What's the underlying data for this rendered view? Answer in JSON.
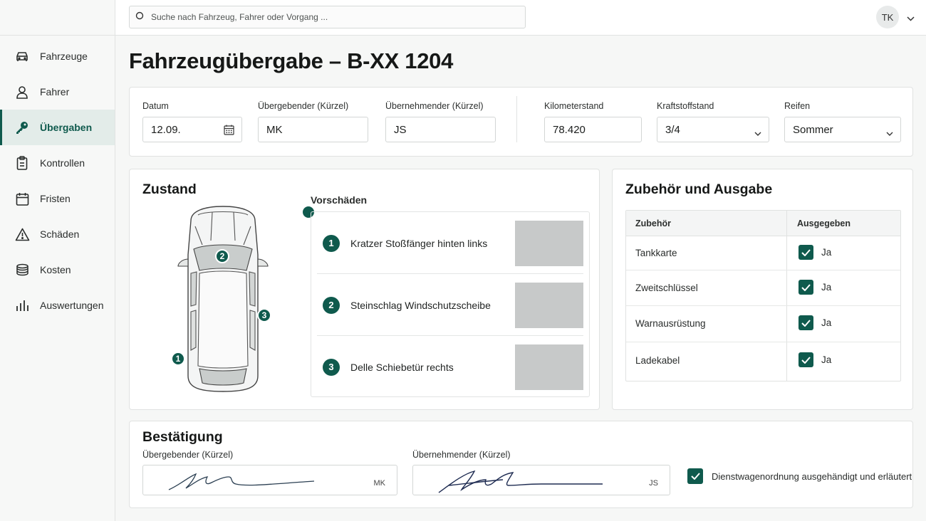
{
  "sidebar": {
    "items": [
      {
        "label": "Fahrzeuge",
        "icon": "car-icon",
        "active": false
      },
      {
        "label": "Fahrer",
        "icon": "user-icon",
        "active": false
      },
      {
        "label": "Übergaben",
        "icon": "key-icon",
        "active": true
      },
      {
        "label": "Kontrollen",
        "icon": "clipboard-icon",
        "active": false
      },
      {
        "label": "Fristen",
        "icon": "calendar-icon",
        "active": false
      },
      {
        "label": "Schäden",
        "icon": "warning-icon",
        "active": false
      },
      {
        "label": "Kosten",
        "icon": "coins-icon",
        "active": false
      },
      {
        "label": "Auswertungen",
        "icon": "bar-chart-icon",
        "active": false
      }
    ]
  },
  "topbar": {
    "search_placeholder": "Suche nach Fahrzeug, Fahrer oder Vorgang ...",
    "user_initials": "TK"
  },
  "page": {
    "title": "Fahrzeugübergabe – B-XX 1204"
  },
  "form": {
    "datum": {
      "label": "Datum",
      "value": "12.09."
    },
    "uebergebender": {
      "label": "Übergebender (Kürzel)",
      "value": "MK"
    },
    "uebernehmender": {
      "label": "Übernehmender (Kürzel)",
      "value": "JS"
    },
    "km": {
      "label": "Kilometerstand",
      "value": "78.420"
    },
    "kraftstoff": {
      "label": "Kraftstoffstand",
      "value": "3/4"
    },
    "reifen": {
      "label": "Reifen",
      "value": "Sommer"
    }
  },
  "zustand": {
    "title": "Zustand",
    "vorschaeden_title": "Vorschäden",
    "markers": [
      "1",
      "2",
      "3"
    ],
    "damages": [
      {
        "num": "1",
        "text": "Kratzer Stoßfänger hinten links"
      },
      {
        "num": "2",
        "text": "Steinschlag Windschutzscheibe"
      },
      {
        "num": "3",
        "text": "Delle Schiebetür rechts"
      }
    ]
  },
  "zubehoer": {
    "title": "Zubehör und Ausgabe",
    "col_item": "Zubehör",
    "col_issued": "Ausgegeben",
    "rows": [
      {
        "item": "Tankkarte",
        "issued": "Ja"
      },
      {
        "item": "Zweitschlüssel",
        "issued": "Ja"
      },
      {
        "item": "Warnausrüstung",
        "issued": "Ja"
      },
      {
        "item": "Ladekabel",
        "issued": "Ja"
      }
    ]
  },
  "bestaetigung": {
    "title": "Bestätigung",
    "sig_giver_label": "Übergebender (Kürzel)",
    "sig_giver_initials": "MK",
    "sig_taker_label": "Übernehmender (Kürzel)",
    "sig_taker_initials": "JS",
    "confirm_text": "Dienstwagenordnung ausgehändigt und erläutert"
  },
  "colors": {
    "accent": "#0f5a4d",
    "photo_placeholder": "#c7c9c9"
  }
}
